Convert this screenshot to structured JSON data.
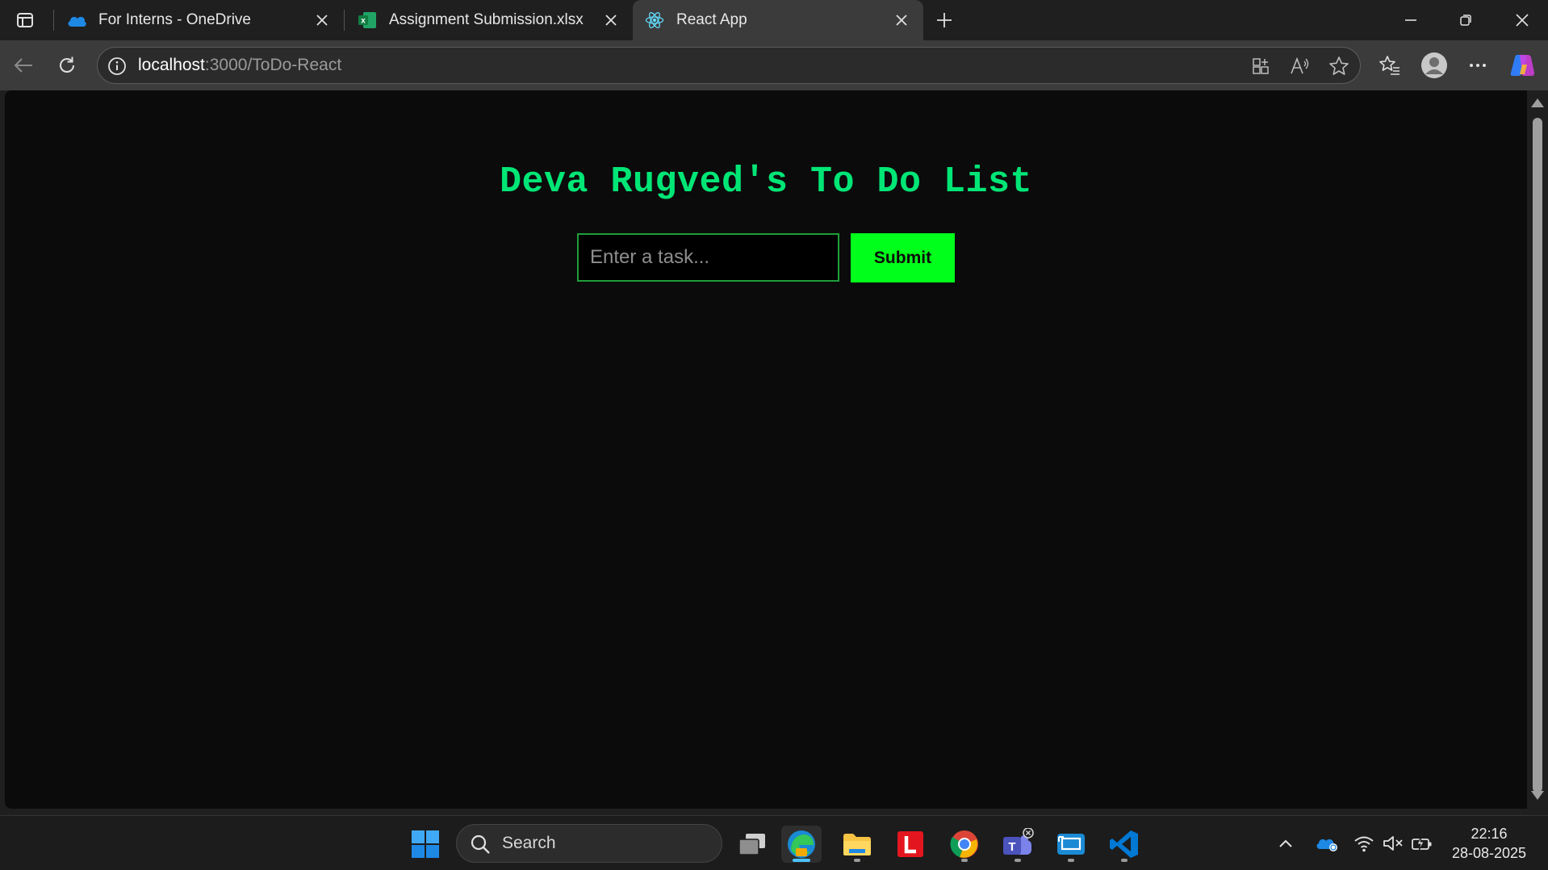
{
  "browser": {
    "tabs": [
      {
        "title": "For Interns - OneDrive",
        "icon": "onedrive-cloud-icon",
        "active": false
      },
      {
        "title": "Assignment Submission.xlsx",
        "icon": "excel-icon",
        "active": false
      },
      {
        "title": "React App",
        "icon": "react-icon",
        "active": true
      }
    ],
    "address": {
      "host": "localhost",
      "path": ":3000/ToDo-React"
    }
  },
  "app": {
    "title": "Deva Rugved's To Do List",
    "input_placeholder": "Enter a task...",
    "submit_label": "Submit",
    "accent_color": "#00e676",
    "button_color": "#00ff1a"
  },
  "taskbar": {
    "search_label": "Search",
    "time": "22:16",
    "date": "28-08-2025"
  }
}
